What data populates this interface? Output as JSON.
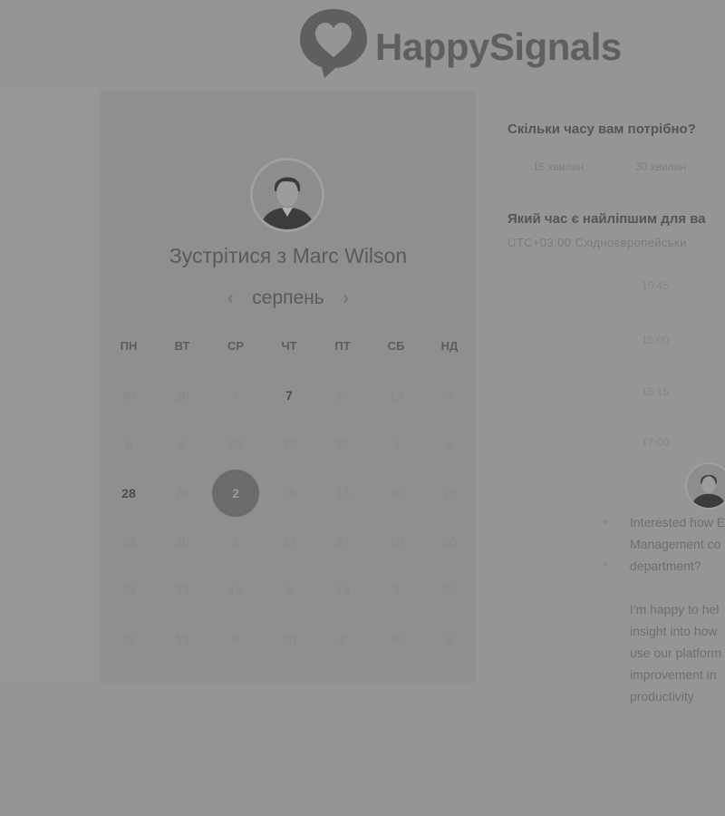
{
  "brand": {
    "name": "HappySignals"
  },
  "calendar": {
    "title": "Зустрітися з Marc Wilson",
    "month": "серпень",
    "prev_icon": "chevron-left-icon",
    "next_icon": "chevron-right-icon",
    "weekdays": [
      "ПН",
      "ВТ",
      "СР",
      "ЧТ",
      "ПТ",
      "СБ",
      "НД"
    ],
    "weeks": [
      [
        "30",
        "26",
        "7",
        "7",
        "27",
        "13",
        "7"
      ],
      [
        "6",
        "4",
        "20",
        "19",
        "22",
        "4",
        "6"
      ],
      [
        "28",
        "26",
        "2",
        "26",
        "13",
        "30",
        "25"
      ],
      [
        "24",
        "20",
        "1",
        "27",
        "27",
        "10",
        "20"
      ],
      [
        "28",
        "23",
        "15",
        "2",
        "18",
        "3",
        "29"
      ],
      [
        "22",
        "19",
        "9",
        "30",
        "8",
        "30",
        "8"
      ]
    ],
    "selected_day": "2"
  },
  "duration": {
    "question": "Скільки часу вам потрібно?",
    "options": [
      "15 хвилин",
      "30 хвилин"
    ]
  },
  "time": {
    "question": "Який час є найліпшим для ва",
    "timezone": "UTC+03:00 Східноєвропейськи",
    "slots": [
      "10:45",
      "15:00",
      "15:15",
      "17:00"
    ]
  },
  "chat": {
    "message1": [
      "Interested how E",
      "Management co",
      "department?"
    ],
    "message2": [
      "I'm happy to hel",
      "insight into how",
      "use our platform",
      "improvement in",
      "productivity"
    ]
  }
}
